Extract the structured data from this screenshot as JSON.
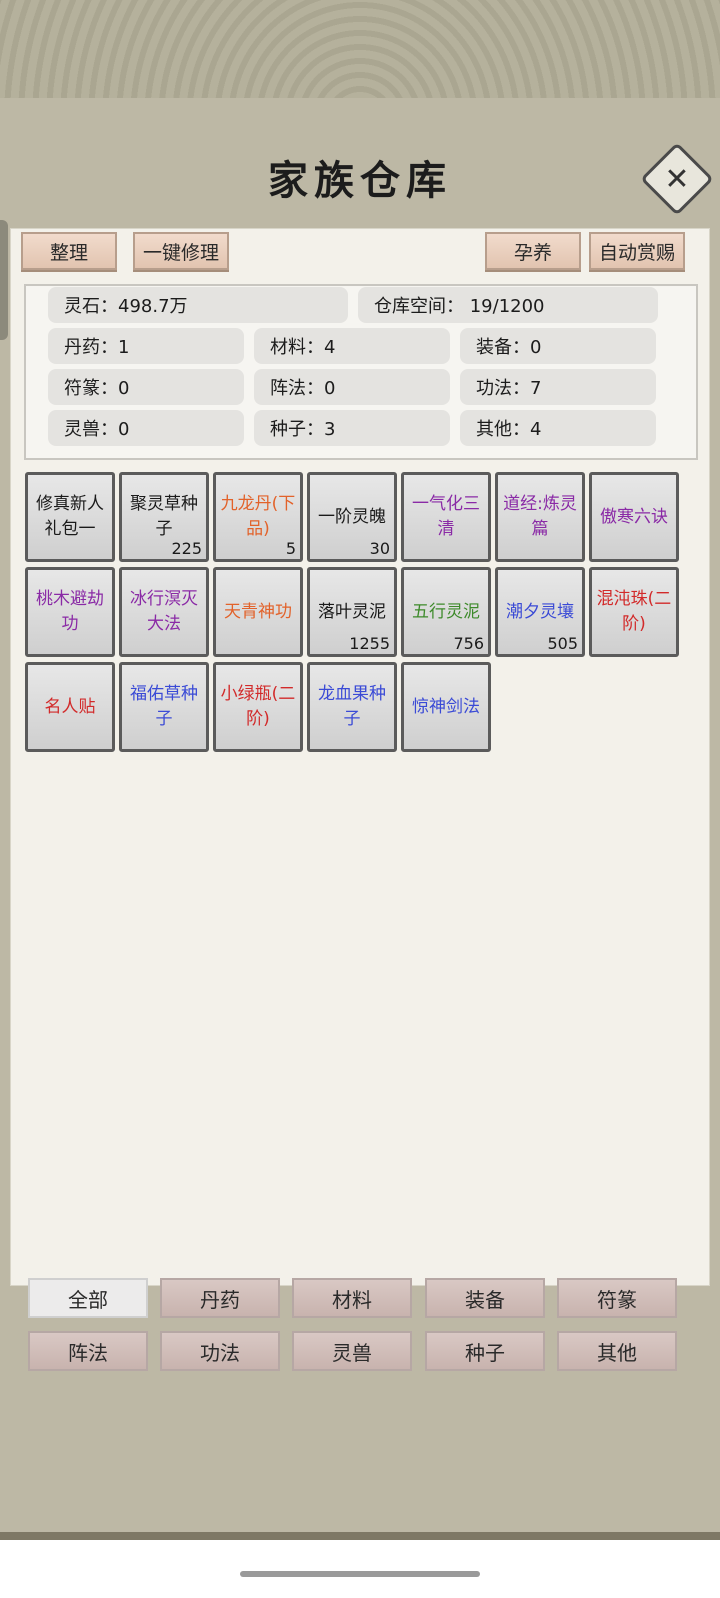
{
  "title": "家族仓库",
  "close_icon": "close-icon",
  "toolbar": {
    "sort": "整理",
    "repair": "一键修理",
    "nurture": "孕养",
    "auto_reward": "自动赏赐"
  },
  "stats": {
    "spirit_stone": "灵石：498.7万",
    "storage": "仓库空间：   19/1200",
    "pill": "丹药：1",
    "material": "材料：4",
    "equipment": "装备：0",
    "talisman": "符篆：0",
    "formation": "阵法：0",
    "technique": "功法：7",
    "beast": "灵兽：0",
    "seed": "种子：3",
    "other": "其他：4"
  },
  "items": [
    {
      "name": "修真新人礼包一",
      "count": "",
      "color": "#1a1a1a"
    },
    {
      "name": "聚灵草种子",
      "count": "225",
      "color": "#1a1a1a"
    },
    {
      "name": "九龙丹(下品)",
      "count": "5",
      "color": "#e2622a"
    },
    {
      "name": "一阶灵魄",
      "count": "30",
      "color": "#1a1a1a"
    },
    {
      "name": "一气化三清",
      "count": "",
      "color": "#8a2aa6"
    },
    {
      "name": "道经:炼灵篇",
      "count": "",
      "color": "#8a2aa6"
    },
    {
      "name": "傲寒六诀",
      "count": "",
      "color": "#8a2aa6"
    },
    {
      "name": "桃木避劫功",
      "count": "",
      "color": "#8a2aa6"
    },
    {
      "name": "冰行溟灭大法",
      "count": "",
      "color": "#8a2aa6"
    },
    {
      "name": "天青神功",
      "count": "",
      "color": "#e2622a"
    },
    {
      "name": "落叶灵泥",
      "count": "1255",
      "color": "#1a1a1a"
    },
    {
      "name": "五行灵泥",
      "count": "756",
      "color": "#3d8a2a"
    },
    {
      "name": "潮夕灵壤",
      "count": "505",
      "color": "#3a4ad6"
    },
    {
      "name": "混沌珠(二阶)",
      "count": "",
      "color": "#d22a2a"
    },
    {
      "name": "名人贴",
      "count": "",
      "color": "#d22a2a"
    },
    {
      "name": "福佑草种子",
      "count": "",
      "color": "#3a4ad6"
    },
    {
      "name": "小绿瓶(二阶)",
      "count": "",
      "color": "#d22a2a"
    },
    {
      "name": "龙血果种子",
      "count": "",
      "color": "#3a4ad6"
    },
    {
      "name": "惊神剑法",
      "count": "",
      "color": "#3a4ad6"
    }
  ],
  "tabs": [
    "全部",
    "丹药",
    "材料",
    "装备",
    "符篆",
    "阵法",
    "功法",
    "灵兽",
    "种子",
    "其他"
  ],
  "active_tab": "全部"
}
